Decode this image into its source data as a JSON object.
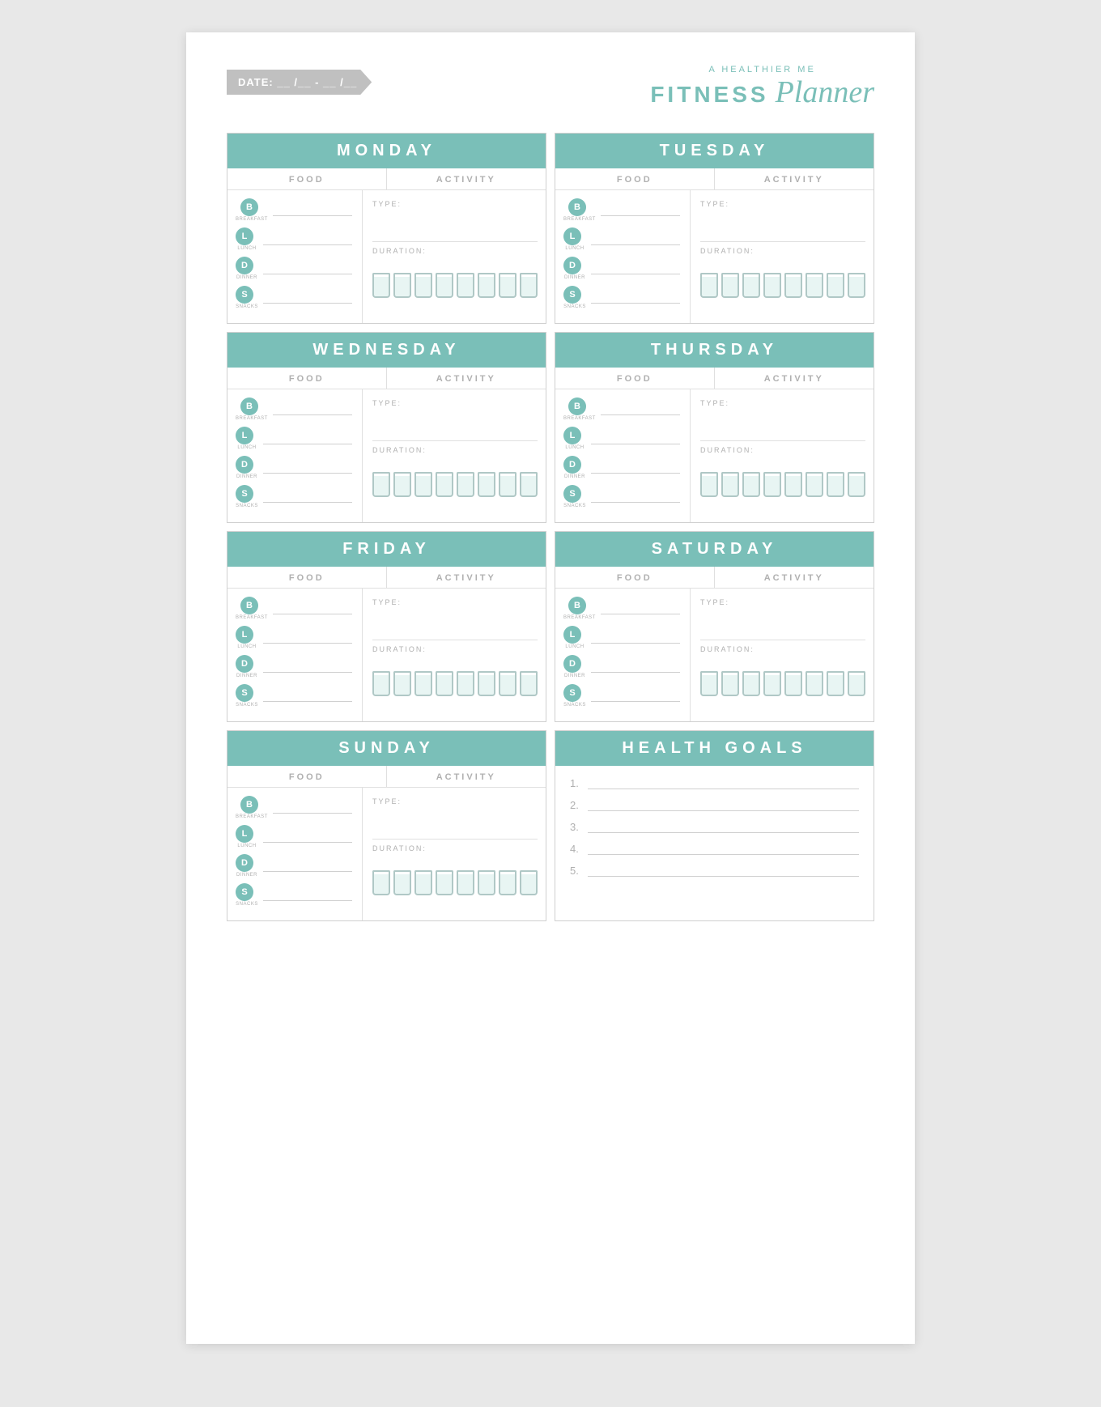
{
  "header": {
    "date_label": "DATE:  __ /__ - __ /__",
    "brand_sub": "A HEALTHIER ME",
    "brand_main": "FITNESS",
    "brand_script": "Planner"
  },
  "days": [
    {
      "id": "monday",
      "name": "MONDAY",
      "meals": [
        {
          "letter": "B",
          "label": "BREAKFAST"
        },
        {
          "letter": "L",
          "label": "LUNCH"
        },
        {
          "letter": "D",
          "label": "DINNER"
        },
        {
          "letter": "S",
          "label": "SNACKS"
        }
      ]
    },
    {
      "id": "tuesday",
      "name": "TUESDAY",
      "meals": [
        {
          "letter": "B",
          "label": "BREAKFAST"
        },
        {
          "letter": "L",
          "label": "LUNCH"
        },
        {
          "letter": "D",
          "label": "DINNER"
        },
        {
          "letter": "S",
          "label": "SNACKS"
        }
      ]
    },
    {
      "id": "wednesday",
      "name": "WEDNESDAY",
      "meals": [
        {
          "letter": "B",
          "label": "BREAKFAST"
        },
        {
          "letter": "L",
          "label": "LUNCH"
        },
        {
          "letter": "D",
          "label": "DINNER"
        },
        {
          "letter": "S",
          "label": "SNACKS"
        }
      ]
    },
    {
      "id": "thursday",
      "name": "THURSDAY",
      "meals": [
        {
          "letter": "B",
          "label": "BREAKFAST"
        },
        {
          "letter": "L",
          "label": "LUNCH"
        },
        {
          "letter": "D",
          "label": "DINNER"
        },
        {
          "letter": "S",
          "label": "SNACKS"
        }
      ]
    },
    {
      "id": "friday",
      "name": "FRIDAY",
      "meals": [
        {
          "letter": "B",
          "label": "BREAKFAST"
        },
        {
          "letter": "L",
          "label": "LUNCH"
        },
        {
          "letter": "D",
          "label": "DINNER"
        },
        {
          "letter": "S",
          "label": "SNACKS"
        }
      ]
    },
    {
      "id": "saturday",
      "name": "SATURDAY",
      "meals": [
        {
          "letter": "B",
          "label": "BREAKFAST"
        },
        {
          "letter": "L",
          "label": "LUNCH"
        },
        {
          "letter": "D",
          "label": "DINNER"
        },
        {
          "letter": "S",
          "label": "SNACKS"
        }
      ]
    },
    {
      "id": "sunday",
      "name": "SUNDAY",
      "meals": [
        {
          "letter": "B",
          "label": "BREAKFAST"
        },
        {
          "letter": "L",
          "label": "LUNCH"
        },
        {
          "letter": "D",
          "label": "DINNER"
        },
        {
          "letter": "S",
          "label": "SNACKS"
        }
      ]
    }
  ],
  "columns": {
    "food": "FOOD",
    "activity": "ACTIVITY"
  },
  "activity": {
    "type_label": "TYPE:",
    "duration_label": "DURATION:"
  },
  "health_goals": {
    "title": "HEALTH GOALS",
    "items": [
      "1.",
      "2.",
      "3.",
      "4.",
      "5."
    ]
  },
  "cups_count": 8
}
